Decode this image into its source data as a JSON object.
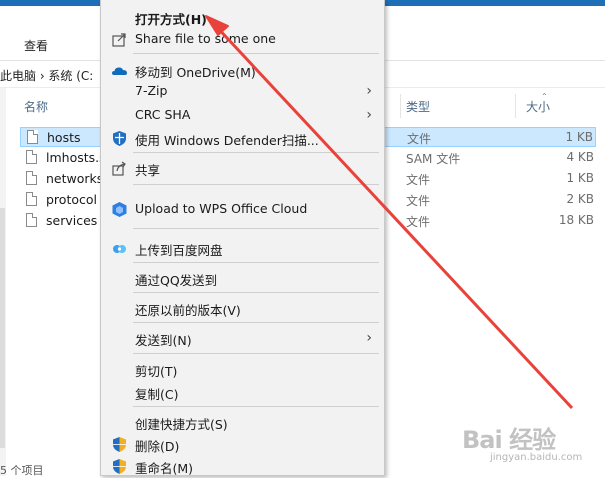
{
  "ribbon": {
    "view_tab": "查看"
  },
  "address": {
    "path": "此电脑  ›  系统 (C:"
  },
  "columns": {
    "name": "名称",
    "type": "类型",
    "size": "大小"
  },
  "files": [
    {
      "name": "hosts",
      "type": "文件",
      "size": "1 KB",
      "selected": true
    },
    {
      "name": "lmhosts.s",
      "type": "SAM 文件",
      "size": "4 KB"
    },
    {
      "name": "networks",
      "type": "文件",
      "size": "1 KB"
    },
    {
      "name": "protocol",
      "type": "文件",
      "size": "2 KB"
    },
    {
      "name": "services",
      "type": "文件",
      "size": "18 KB"
    }
  ],
  "status": {
    "count": "5 个项目"
  },
  "context_menu": {
    "open_with": "打开方式(H)",
    "share_file": "Share file to some one",
    "onedrive": "移动到 OneDrive(M)",
    "seven_zip": "7-Zip",
    "crc_sha": "CRC SHA",
    "defender": "使用 Windows Defender扫描...",
    "share": "共享",
    "wps_upload": "Upload to WPS Office Cloud",
    "baidu_upload": "上传到百度网盘",
    "qq_send": "通过QQ发送到",
    "restore_prev": "还原以前的版本(V)",
    "send_to": "发送到(N)",
    "cut": "剪切(T)",
    "copy": "复制(C)",
    "create_shortcut": "创建快捷方式(S)",
    "delete": "删除(D)",
    "rename": "重命名(M)"
  },
  "watermark": {
    "logo": "Bai 经验",
    "url": "jingyan.baidu.com"
  },
  "colors": {
    "accent": "#1e6fb8",
    "selection": "#cce8ff",
    "arrow": "#e8423a",
    "menu_bg": "#f2f2f2"
  }
}
